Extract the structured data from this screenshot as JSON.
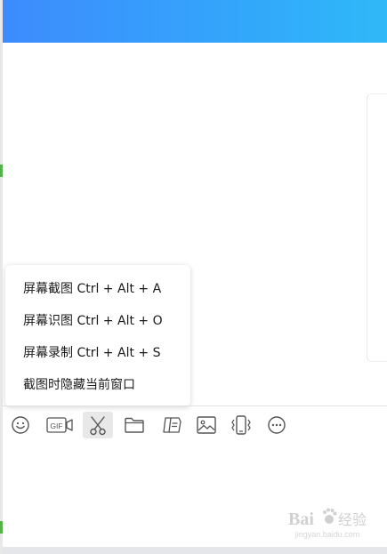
{
  "menu": {
    "items": [
      {
        "label": "屏幕截图 Ctrl + Alt + A"
      },
      {
        "label": "屏幕识图 Ctrl + Alt + O"
      },
      {
        "label": "屏幕录制 Ctrl + Alt + S"
      },
      {
        "label": "截图时隐藏当前窗口"
      }
    ]
  },
  "toolbar": {
    "tools": [
      {
        "icon": "emoji-icon"
      },
      {
        "icon": "gif-icon",
        "label": "GIF"
      },
      {
        "icon": "scissors-icon",
        "active": true
      },
      {
        "icon": "folder-icon"
      },
      {
        "icon": "document-icon"
      },
      {
        "icon": "image-icon"
      },
      {
        "icon": "shake-window-icon"
      },
      {
        "icon": "more-icon"
      }
    ]
  },
  "watermark": {
    "text": "jingyan.baidu.com",
    "brand": "Bai du"
  },
  "colors": {
    "header_start": "#3d8bfd",
    "header_end": "#2fb9f8",
    "icon": "#555555",
    "active_bg": "#e8e8e8"
  }
}
